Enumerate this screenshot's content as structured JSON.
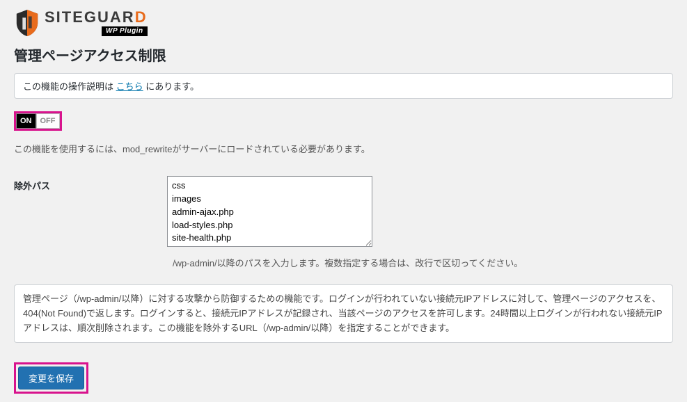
{
  "logo": {
    "title_pre": "SITEGUAR",
    "title_accent": "D",
    "sub": "WP Plugin"
  },
  "page_title": "管理ページアクセス制限",
  "notice": {
    "pre": "この機能の操作説明は ",
    "link": "こちら",
    "post": " にあります。"
  },
  "toggle": {
    "on": "ON",
    "off": "OFF"
  },
  "requirement": "この機能を使用するには、mod_rewriteがサーバーにロードされている必要があります。",
  "form": {
    "exclude_label": "除外パス",
    "exclude_value": "css\nimages\nadmin-ajax.php\nload-styles.php\nsite-health.php",
    "exclude_hint": "/wp-admin/以降のパスを入力します。複数指定する場合は、改行で区切ってください。"
  },
  "description": "管理ページ（/wp-admin/以降）に対する攻撃から防御するための機能です。ログインが行われていない接続元IPアドレスに対して、管理ページのアクセスを、404(Not Found)で返します。ログインすると、接続元IPアドレスが記録され、当該ページのアクセスを許可します。24時間以上ログインが行われない接続元IPアドレスは、順次削除されます。この機能を除外するURL（/wp-admin/以降）を指定することができます。",
  "submit_label": "変更を保存"
}
